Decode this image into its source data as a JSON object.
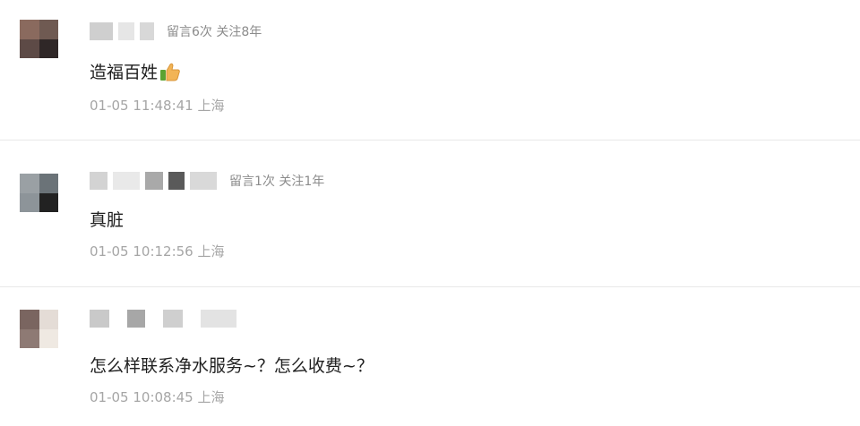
{
  "comments": [
    {
      "stats": "留言6次 关注8年",
      "text": "造福百姓",
      "emoji": "thumbs-up",
      "time": "01-05 11:48:41 上海",
      "avatar_colors": [
        "#8a6a5e",
        "#6f5a52",
        "#5d4a46",
        "#2f2727"
      ],
      "name_colors": [
        "#cfcfcf",
        "#e6e6e6",
        "#d8d8d8"
      ]
    },
    {
      "stats": "留言1次 关注1年",
      "text": "真脏",
      "time": "01-05 10:12:56 上海",
      "avatar_colors": [
        "#9aa0a4",
        "#6b7378",
        "#8d9499",
        "#222222"
      ],
      "name_colors": [
        "#d3d3d3",
        "#e9e9e9",
        "#a9a9a9",
        "#5a5a5a",
        "#d9d9d9"
      ]
    },
    {
      "stats": "",
      "text": "怎么样联系净水服务~？怎么收费~？",
      "time": "01-05 10:08:45 上海",
      "avatar_colors": [
        "#7a6560",
        "#e4dcd6",
        "#8e7a74",
        "#efe9e2"
      ],
      "name_colors": [
        "#c9c9c9",
        "#a7a7a7",
        "#cfcfcf",
        "#e3e3e3"
      ]
    }
  ],
  "colors": {
    "text": "#1f1f1f",
    "meta": "#8c8c8c",
    "time": "#a6a6a6",
    "divider": "#e8e8e8",
    "thumb": "#f2b455"
  }
}
